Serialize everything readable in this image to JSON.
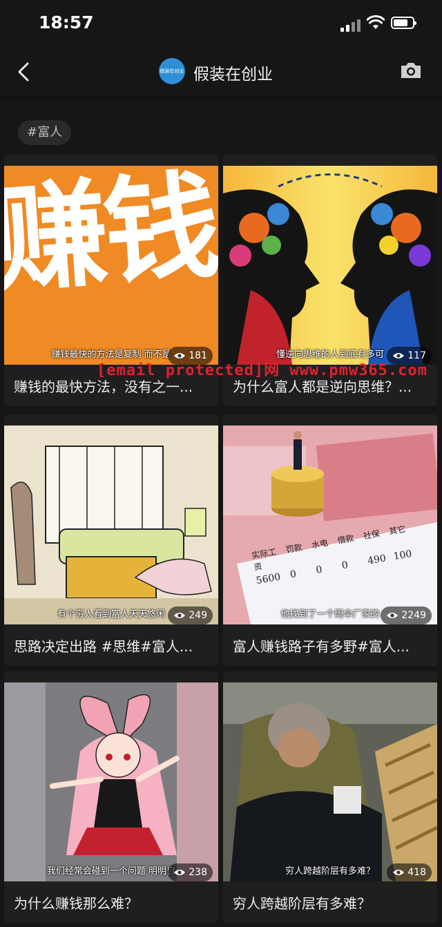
{
  "status": {
    "time": "18:57"
  },
  "nav": {
    "avatar_text": "假装在创业",
    "title": "假装在创业"
  },
  "tag": "#富人",
  "watermark": "[email protected]网 www.pmw365.com",
  "cards": [
    {
      "caption": "赚钱最快的方法是复制 而不是",
      "views": "181",
      "title": "赚钱的最快方法，没有之一...",
      "thumb_text": "赚钱"
    },
    {
      "caption": "懂逆向思维的人到底有多可",
      "views": "117",
      "title": "为什么富人都是逆向思维？..."
    },
    {
      "caption": "有个穷人看到富人天天悠闲",
      "views": "249",
      "title": "思路决定出路 #思维#富人..."
    },
    {
      "caption": "他找到了一个雨伞厂家的",
      "views": "2249",
      "title": "富人赚钱路子有多野#富人..."
    },
    {
      "caption": "我们经常会碰到一个问题 明明自",
      "views": "238",
      "title": "为什么赚钱那么难？"
    },
    {
      "caption": "穷人跨越阶层有多难？",
      "views": "418",
      "title": "穷人跨越阶层有多难？"
    }
  ],
  "salary_slip": {
    "header": [
      "实际工资",
      "罚款",
      "水电",
      "借款",
      "社保",
      "其它"
    ],
    "values": [
      "5600",
      "0",
      "0",
      "0",
      "490",
      "100"
    ]
  }
}
